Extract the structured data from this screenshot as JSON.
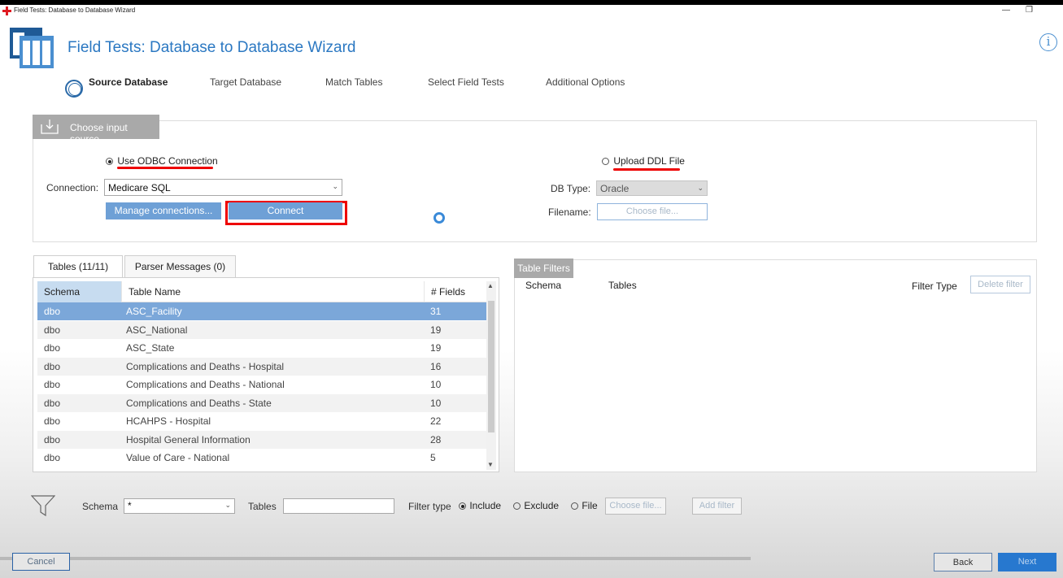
{
  "window": {
    "title": "Field Tests: Database to Database Wizard",
    "minimize_glyph": "—",
    "restore_glyph": "❐"
  },
  "header": {
    "title": "Field Tests: Database to Database Wizard",
    "info_glyph": "i"
  },
  "steps": [
    "Source Database",
    "Target Database",
    "Match Tables",
    "Select Field Tests",
    "Additional Options"
  ],
  "source": {
    "section_label": "Choose input source",
    "odbc_label": "Use ODBC Connection",
    "ddl_label": "Upload DDL File",
    "connection_label": "Connection:",
    "connection_value": "Medicare SQL",
    "manage_label": "Manage connections...",
    "connect_label": "Connect",
    "dbtype_label": "DB Type:",
    "dbtype_value": "Oracle",
    "filename_label": "Filename:",
    "choose_file_label": "Choose file..."
  },
  "tabs": {
    "tables": "Tables (11/11)",
    "parser": "Parser Messages (0)"
  },
  "table": {
    "columns": [
      "Schema",
      "Table Name",
      "# Fields"
    ],
    "rows": [
      [
        "dbo",
        "ASC_Facility",
        "31"
      ],
      [
        "dbo",
        "ASC_National",
        "19"
      ],
      [
        "dbo",
        "ASC_State",
        "19"
      ],
      [
        "dbo",
        "Complications and Deaths - Hospital",
        "16"
      ],
      [
        "dbo",
        "Complications and Deaths - National",
        "10"
      ],
      [
        "dbo",
        "Complications and Deaths - State",
        "10"
      ],
      [
        "dbo",
        "HCAHPS - Hospital",
        "22"
      ],
      [
        "dbo",
        "Hospital General Information",
        "28"
      ],
      [
        "dbo",
        "Value of Care - National",
        "5"
      ]
    ],
    "selected_row": 0
  },
  "filters": {
    "tab_label": "Table Filters",
    "col_schema": "Schema",
    "col_tables": "Tables",
    "col_filter_type": "Filter Type",
    "delete_label": "Delete filter"
  },
  "filter_bar": {
    "schema_label": "Schema",
    "schema_value": "*",
    "tables_label": "Tables",
    "filter_type_label": "Filter type",
    "include_label": "Include",
    "exclude_label": "Exclude",
    "file_label": "File",
    "choose_file_label": "Choose file...",
    "add_filter_label": "Add filter"
  },
  "footer": {
    "cancel_label": "Cancel",
    "back_label": "Back",
    "next_label": "Next"
  },
  "colors": {
    "accent": "#2b78c2",
    "selected_row": "#7ba7d9",
    "highlight": "#e00000"
  }
}
